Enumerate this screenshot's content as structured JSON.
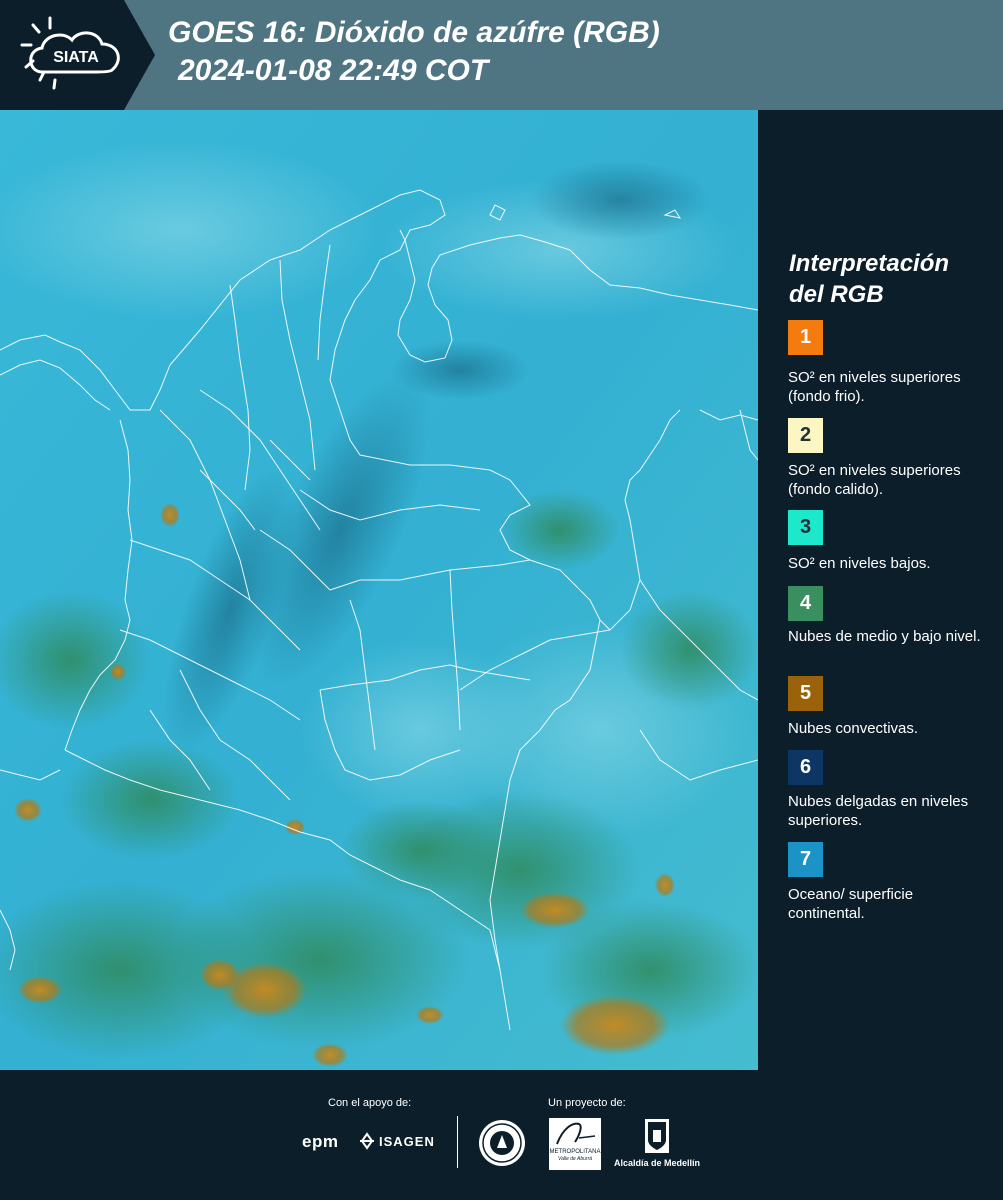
{
  "header": {
    "logo_text": "SIATA",
    "title_line1": "GOES 16: Dióxido de azúfre (RGB)",
    "title_line2": "2024-01-08 22:49 COT"
  },
  "legend": {
    "title": "Interpretación del RGB",
    "items": [
      {
        "number": "1",
        "color": "#f47c0f",
        "text_color": "#ffffff",
        "description": "SO² en niveles superiores (fondo frio)."
      },
      {
        "number": "2",
        "color": "#fcf7c2",
        "text_color": "#23303a",
        "description": "SO² en niveles superiores (fondo calido)."
      },
      {
        "number": "3",
        "color": "#1de8cc",
        "text_color": "#23303a",
        "description": "SO² en niveles bajos."
      },
      {
        "number": "4",
        "color": "#3a8f5f",
        "text_color": "#ffffff",
        "description": "Nubes de medio y bajo nivel."
      },
      {
        "number": "5",
        "color": "#9a630b",
        "text_color": "#ffffff",
        "description": "Nubes convectivas."
      },
      {
        "number": "6",
        "color": "#0e3664",
        "text_color": "#ffffff",
        "description": "Nubes delgadas en niveles superiores."
      },
      {
        "number": "7",
        "color": "#1b93c6",
        "text_color": "#ffffff",
        "description": "Oceano/ superficie continental."
      }
    ]
  },
  "footer": {
    "support_label": "Con el apoyo de:",
    "project_label": "Un proyecto de:",
    "sponsor_epm": "epm",
    "sponsor_isagen": "ISAGEN",
    "partner_metropolitana": "METROPOLITANA",
    "partner_valle": "Valle de Aburrá",
    "partner_alcaldia": "Alcaldía de Medellín"
  },
  "map": {
    "region": "Colombia",
    "base_color": "#3ab8d6",
    "border_color": "#ffffff"
  }
}
